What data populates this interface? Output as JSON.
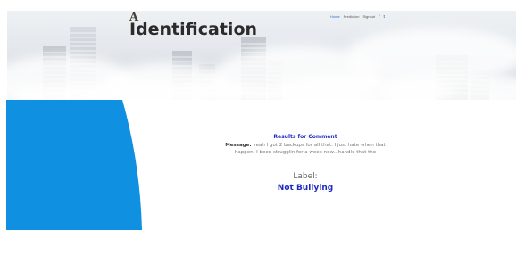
{
  "header": {
    "logo_mark": "A",
    "title": "Identification",
    "nav": [
      {
        "label": "Home",
        "active": true
      },
      {
        "label": "Prediction",
        "active": false
      },
      {
        "label": "Signout",
        "active": false
      }
    ],
    "social": [
      "f",
      "t"
    ]
  },
  "result": {
    "heading": "Results for Comment",
    "message_label": "Message:",
    "message_text": "yeah I got 2 backups for all that. I just hate when that happen. I been strugglin for a week now...handle that tho",
    "label_heading": "Label:",
    "label_value": "Not Bullying"
  },
  "colors": {
    "accent": "#1f2bbf",
    "shape_blue": "#0f90e0",
    "nav_active": "#3b6fd6"
  },
  "icons": [
    "logo-icon",
    "facebook-icon",
    "twitter-icon"
  ]
}
